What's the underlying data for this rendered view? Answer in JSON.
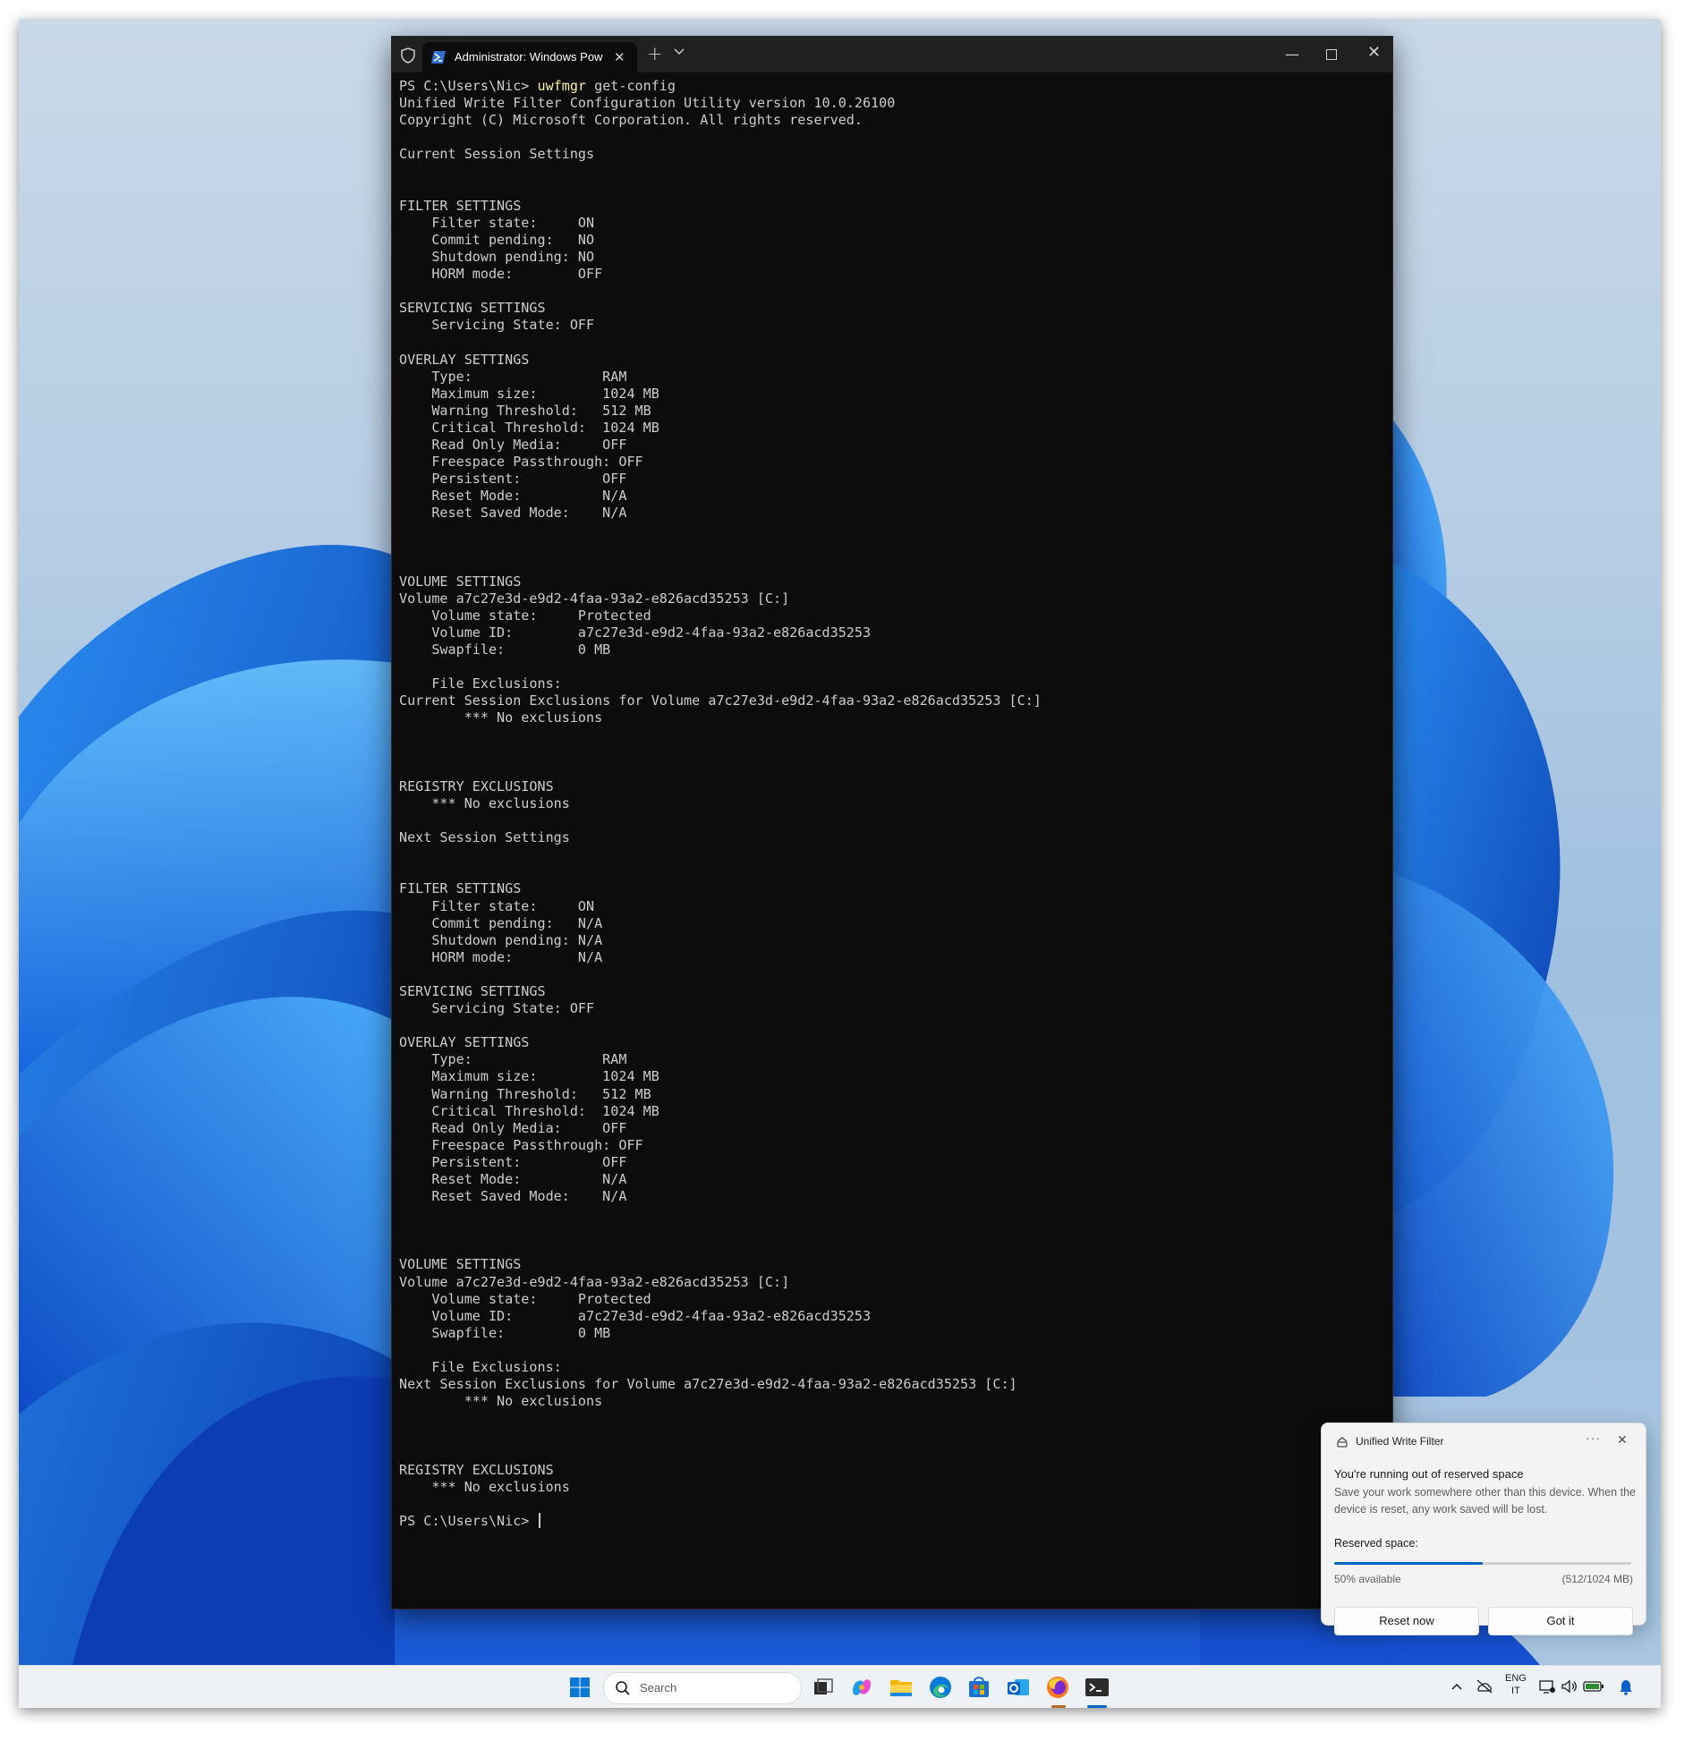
{
  "terminal": {
    "tab_title": "Administrator: Windows Pow",
    "prompt": "PS C:\\Users\\Nic> ",
    "command_name": "uwfmgr",
    "command_args": " get-config",
    "output": "Unified Write Filter Configuration Utility version 10.0.26100\nCopyright (C) Microsoft Corporation. All rights reserved.\n\nCurrent Session Settings\n\n\nFILTER SETTINGS\n    Filter state:     ON\n    Commit pending:   NO\n    Shutdown pending: NO\n    HORM mode:        OFF\n\nSERVICING SETTINGS\n    Servicing State: OFF\n\nOVERLAY SETTINGS\n    Type:                RAM\n    Maximum size:        1024 MB\n    Warning Threshold:   512 MB\n    Critical Threshold:  1024 MB\n    Read Only Media:     OFF\n    Freespace Passthrough: OFF\n    Persistent:          OFF\n    Reset Mode:          N/A\n    Reset Saved Mode:    N/A\n\n\n\nVOLUME SETTINGS\nVolume a7c27e3d-e9d2-4faa-93a2-e826acd35253 [C:]\n    Volume state:     Protected\n    Volume ID:        a7c27e3d-e9d2-4faa-93a2-e826acd35253\n    Swapfile:         0 MB\n\n    File Exclusions:\nCurrent Session Exclusions for Volume a7c27e3d-e9d2-4faa-93a2-e826acd35253 [C:]\n        *** No exclusions\n\n\n\nREGISTRY EXCLUSIONS\n    *** No exclusions\n\nNext Session Settings\n\n\nFILTER SETTINGS\n    Filter state:     ON\n    Commit pending:   N/A\n    Shutdown pending: N/A\n    HORM mode:        N/A\n\nSERVICING SETTINGS\n    Servicing State: OFF\n\nOVERLAY SETTINGS\n    Type:                RAM\n    Maximum size:        1024 MB\n    Warning Threshold:   512 MB\n    Critical Threshold:  1024 MB\n    Read Only Media:     OFF\n    Freespace Passthrough: OFF\n    Persistent:          OFF\n    Reset Mode:          N/A\n    Reset Saved Mode:    N/A\n\n\n\nVOLUME SETTINGS\nVolume a7c27e3d-e9d2-4faa-93a2-e826acd35253 [C:]\n    Volume state:     Protected\n    Volume ID:        a7c27e3d-e9d2-4faa-93a2-e826acd35253\n    Swapfile:         0 MB\n\n    File Exclusions:\nNext Session Exclusions for Volume a7c27e3d-e9d2-4faa-93a2-e826acd35253 [C:]\n        *** No exclusions\n\n\n\nREGISTRY EXCLUSIONS\n    *** No exclusions\n\n",
    "final_prompt": "PS C:\\Users\\Nic> ",
    "colors": {
      "background": "#0c0c0c",
      "text": "#cccccc",
      "command": "#f9f1a5",
      "titlebar": "#202020"
    }
  },
  "toast": {
    "app_name": "Unified Write Filter",
    "more_glyph": "···",
    "close_glyph": "✕",
    "heading": "You're running out of reserved space",
    "body": "Save your work somewhere other than this device. When the device is reset, any work saved will be lost.",
    "reserved_label": "Reserved space:",
    "used_fraction": 0.5,
    "available_text": "50% available",
    "size_text": "(512/1024 MB)",
    "reset_label": "Reset now",
    "gotit_label": "Got it",
    "accent": "#0067c0"
  },
  "taskbar": {
    "search_placeholder": "Search",
    "lang_line1": "ENG",
    "lang_line2": "IT",
    "apps": [
      "start-icon",
      "search-icon",
      "task-view-icon",
      "copilot-icon",
      "file-explorer-icon",
      "edge-icon",
      "store-icon",
      "outlook-icon",
      "firefox-icon",
      "terminal-icon"
    ],
    "tray": [
      "chevron-up-icon",
      "onedrive-off-icon",
      "network-icon",
      "volume-icon",
      "battery-icon",
      "notification-bell-icon"
    ]
  }
}
